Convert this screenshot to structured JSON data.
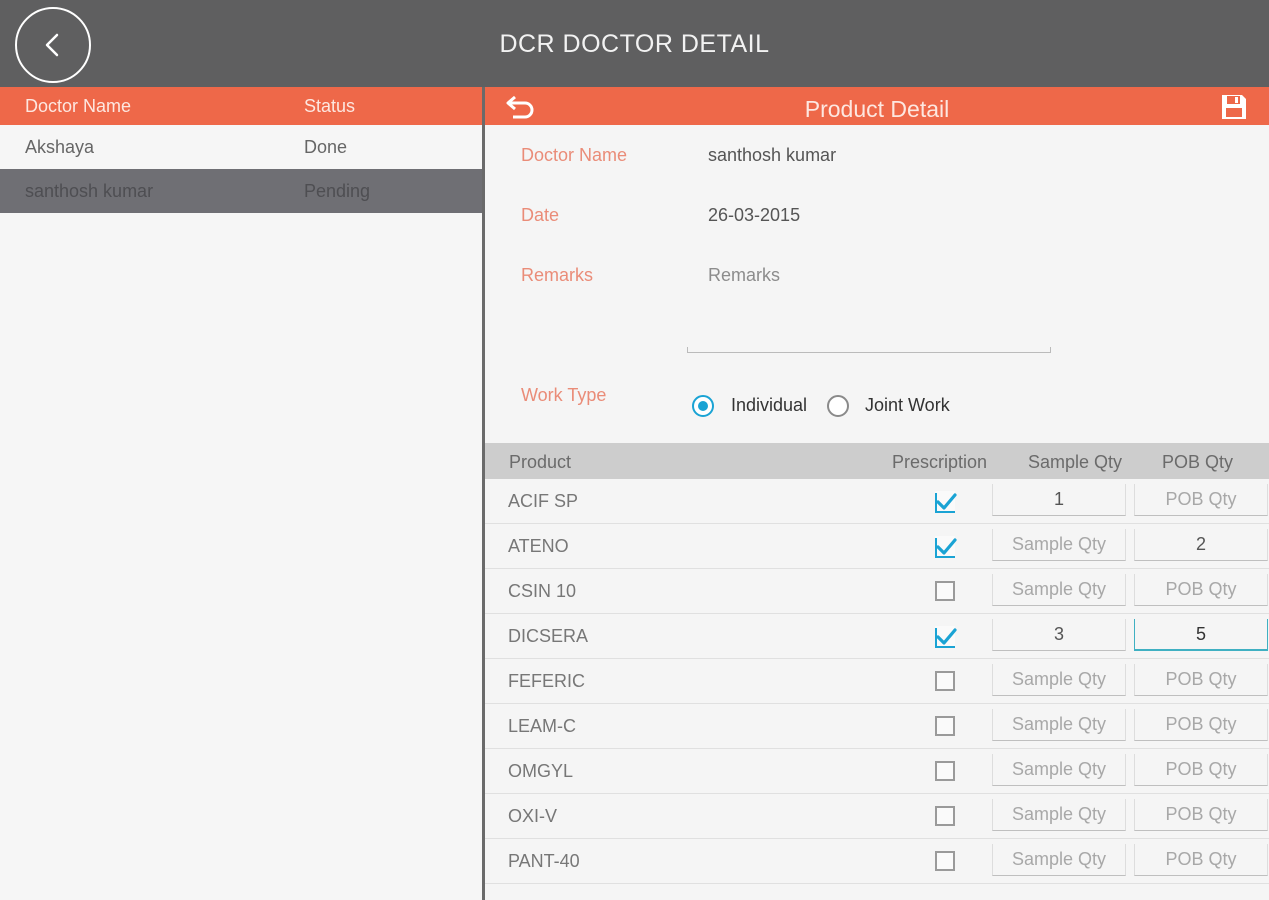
{
  "app": {
    "title": "DCR DOCTOR DETAIL",
    "back_icon": "chevron-left-icon"
  },
  "doctor_list": {
    "headers": {
      "name": "Doctor Name",
      "status": "Status"
    },
    "rows": [
      {
        "name": "Akshaya",
        "status": "Done",
        "selected": false
      },
      {
        "name": "santhosh kumar",
        "status": "Pending",
        "selected": true
      }
    ]
  },
  "detail": {
    "title": "Product Detail",
    "undo_icon": "undo-icon",
    "save_icon": "save-icon",
    "doctor_label": "Doctor Name",
    "doctor_value": "santhosh kumar",
    "date_label": "Date",
    "date_value": "26-03-2015",
    "remarks_label": "Remarks",
    "remarks_placeholder": "Remarks",
    "worktype_label": "Work Type",
    "worktype_options": [
      "Individual",
      "Joint Work"
    ],
    "worktype_selected": "Individual"
  },
  "products": {
    "headers": {
      "product": "Product",
      "prescription": "Prescription",
      "sample": "Sample Qty",
      "pob": "POB Qty"
    },
    "placeholders": {
      "sample": "Sample Qty",
      "pob": "POB Qty"
    },
    "rows": [
      {
        "name": "ACIF SP",
        "prescription": true,
        "sample": "1",
        "pob": ""
      },
      {
        "name": "ATENO",
        "prescription": true,
        "sample": "",
        "pob": "2"
      },
      {
        "name": "CSIN 10",
        "prescription": false,
        "sample": "",
        "pob": ""
      },
      {
        "name": "DICSERA",
        "prescription": true,
        "sample": "3",
        "pob": "5"
      },
      {
        "name": "FEFERIC",
        "prescription": false,
        "sample": "",
        "pob": ""
      },
      {
        "name": "LEAM-C",
        "prescription": false,
        "sample": "",
        "pob": ""
      },
      {
        "name": "OMGYL",
        "prescription": false,
        "sample": "",
        "pob": ""
      },
      {
        "name": "OXI-V",
        "prescription": false,
        "sample": "",
        "pob": ""
      },
      {
        "name": "PANT-40",
        "prescription": false,
        "sample": "",
        "pob": ""
      }
    ]
  },
  "colors": {
    "accent": "#ee6849",
    "topbar": "#5f5f60",
    "check": "#1aa3d4",
    "label": "#ea8c78"
  }
}
